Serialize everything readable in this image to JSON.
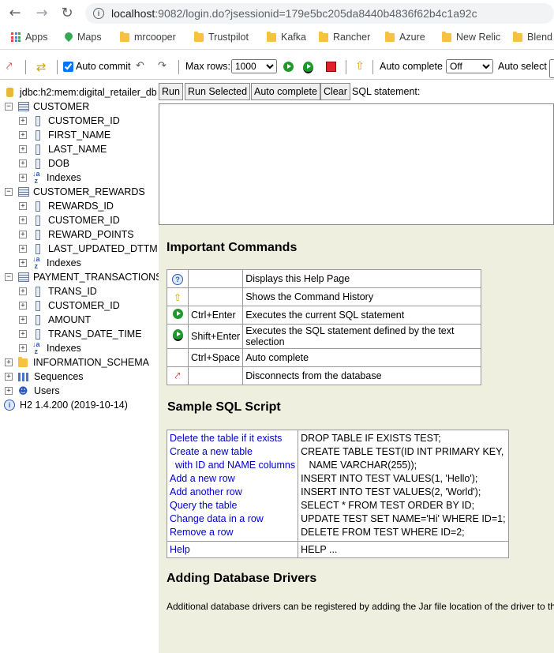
{
  "browser": {
    "url_host": "localhost",
    "url_rest": ":9082/login.do?jsessionid=179e5bc205da8440b4836f62b4c1a92c",
    "bookmarks": [
      "Apps",
      "Maps",
      "mrcooper",
      "Trustpilot",
      "Kafka",
      "Rancher",
      "Azure",
      "New Relic",
      "Blend"
    ]
  },
  "toolbar": {
    "auto_commit_label": "Auto commit",
    "auto_commit_checked": true,
    "max_rows_label": "Max rows:",
    "max_rows_value": "1000",
    "auto_complete_label": "Auto complete",
    "auto_complete_value": "Off",
    "auto_select_label": "Auto select"
  },
  "tree": {
    "db": "jdbc:h2:mem:digital_retailer_db",
    "tables": [
      {
        "name": "CUSTOMER",
        "columns": [
          "CUSTOMER_ID",
          "FIRST_NAME",
          "LAST_NAME",
          "DOB"
        ],
        "indexes": "Indexes"
      },
      {
        "name": "CUSTOMER_REWARDS",
        "columns": [
          "REWARDS_ID",
          "CUSTOMER_ID",
          "REWARD_POINTS",
          "LAST_UPDATED_DTTM"
        ],
        "indexes": "Indexes"
      },
      {
        "name": "PAYMENT_TRANSACTIONS",
        "columns": [
          "TRANS_ID",
          "CUSTOMER_ID",
          "AMOUNT",
          "TRANS_DATE_TIME"
        ],
        "indexes": "Indexes"
      }
    ],
    "info_schema": "INFORMATION_SCHEMA",
    "sequences": "Sequences",
    "users": "Users",
    "version": "H2 1.4.200 (2019-10-14)"
  },
  "buttons": {
    "run": "Run",
    "run_selected": "Run Selected",
    "auto_complete": "Auto complete",
    "clear": "Clear",
    "sql_label": "SQL statement:"
  },
  "help": {
    "important_title": "Important Commands",
    "commands": [
      {
        "icon": "help-icon",
        "key": "",
        "desc": "Displays this Help Page"
      },
      {
        "icon": "history-icon",
        "key": "",
        "desc": "Shows the Command History"
      },
      {
        "icon": "run-icon",
        "key": "Ctrl+Enter",
        "desc": "Executes the current SQL statement"
      },
      {
        "icon": "run-selected-icon",
        "key": "Shift+Enter",
        "desc": "Executes the SQL statement defined by the text selection"
      },
      {
        "icon": "",
        "key": "Ctrl+Space",
        "desc": "Auto complete"
      },
      {
        "icon": "disconnect-icon",
        "key": "",
        "desc": "Disconnects from the database"
      }
    ],
    "sample_title": "Sample SQL Script",
    "sample_rows": [
      {
        "label": "Delete the table if it exists",
        "sql": "DROP TABLE IF EXISTS TEST;"
      },
      {
        "label": "Create a new table",
        "sql": "CREATE TABLE TEST(ID INT PRIMARY KEY,"
      },
      {
        "label": "  with ID and NAME columns",
        "sql": "   NAME VARCHAR(255));"
      },
      {
        "label": "Add a new row",
        "sql": "INSERT INTO TEST VALUES(1, 'Hello');"
      },
      {
        "label": "Add another row",
        "sql": "INSERT INTO TEST VALUES(2, 'World');"
      },
      {
        "label": "Query the table",
        "sql": "SELECT * FROM TEST ORDER BY ID;"
      },
      {
        "label": "Change data in a row",
        "sql": "UPDATE TEST SET NAME='Hi' WHERE ID=1;"
      },
      {
        "label": "Remove a row",
        "sql": "DELETE FROM TEST WHERE ID=2;"
      }
    ],
    "help_label": "Help",
    "help_sql": "HELP ...",
    "drivers_title": "Adding Database Drivers",
    "drivers_text": "Additional database drivers can be registered by adding the Jar file location of the driver to th"
  }
}
